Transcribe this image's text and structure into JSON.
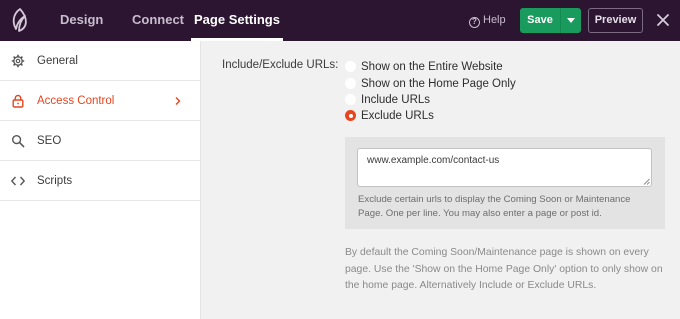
{
  "topbar": {
    "tabs": [
      {
        "label": "Design"
      },
      {
        "label": "Connect"
      },
      {
        "label": "Page Settings"
      }
    ],
    "help_label": "Help",
    "save_label": "Save",
    "preview_label": "Preview",
    "colors": {
      "background": "#2b1531",
      "save": "#1a9b5e",
      "accent": "#e5451f"
    }
  },
  "sidebar": {
    "items": [
      {
        "label": "General",
        "icon": "gear-icon"
      },
      {
        "label": "Access Control",
        "icon": "lock-icon",
        "active": true
      },
      {
        "label": "SEO",
        "icon": "search-icon"
      },
      {
        "label": "Scripts",
        "icon": "code-icon"
      }
    ]
  },
  "main": {
    "field_label": "Include/Exclude URLs:",
    "options": [
      {
        "label": "Show on the Entire Website",
        "checked": false
      },
      {
        "label": "Show on the Home Page Only",
        "checked": false
      },
      {
        "label": "Include URLs",
        "checked": false
      },
      {
        "label": "Exclude URLs",
        "checked": true
      }
    ],
    "url_input": {
      "value": "www.example.com/contact-us"
    },
    "url_help": "Exclude certain urls to display the Coming Soon or Maintenance Page. One per line. You may also enter a page or post id.",
    "info": "By default the Coming Soon/Maintenance page is shown on every page. Use the 'Show on the Home Page Only' option to only show on the home page. Alternatively Include or Exclude URLs."
  }
}
